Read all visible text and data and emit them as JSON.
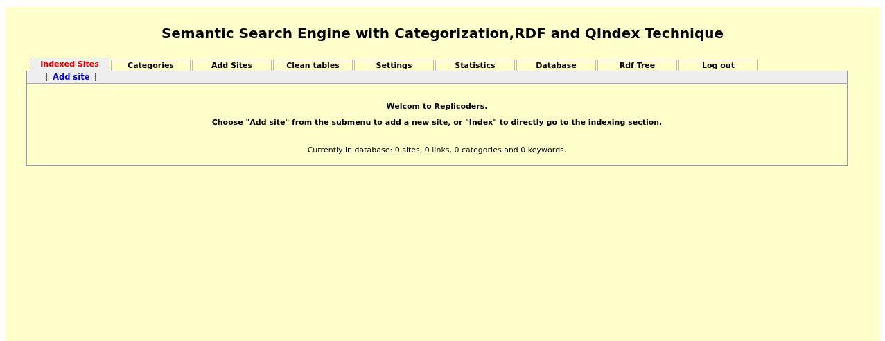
{
  "title": "Semantic Search Engine with Categorization,RDF and QIndex Technique",
  "tabs": [
    {
      "label": "Indexed Sites",
      "selected": true
    },
    {
      "label": "Categories",
      "selected": false
    },
    {
      "label": "Add Sites",
      "selected": false
    },
    {
      "label": "Clean tables",
      "selected": false
    },
    {
      "label": "Settings",
      "selected": false
    },
    {
      "label": "Statistics",
      "selected": false
    },
    {
      "label": "Database",
      "selected": false
    },
    {
      "label": "Rdf Tree",
      "selected": false
    },
    {
      "label": "Log out",
      "selected": false
    }
  ],
  "submenu": [
    "Add site"
  ],
  "content": {
    "heading": "Welcom to Replicoders.",
    "instructions": "Choose \"Add site\" from the submenu to add a new site, or \"Index\" to directly go to the indexing section.",
    "status": "Currently in database: 0 sites, 0 links, 0 categories and 0 keywords."
  }
}
